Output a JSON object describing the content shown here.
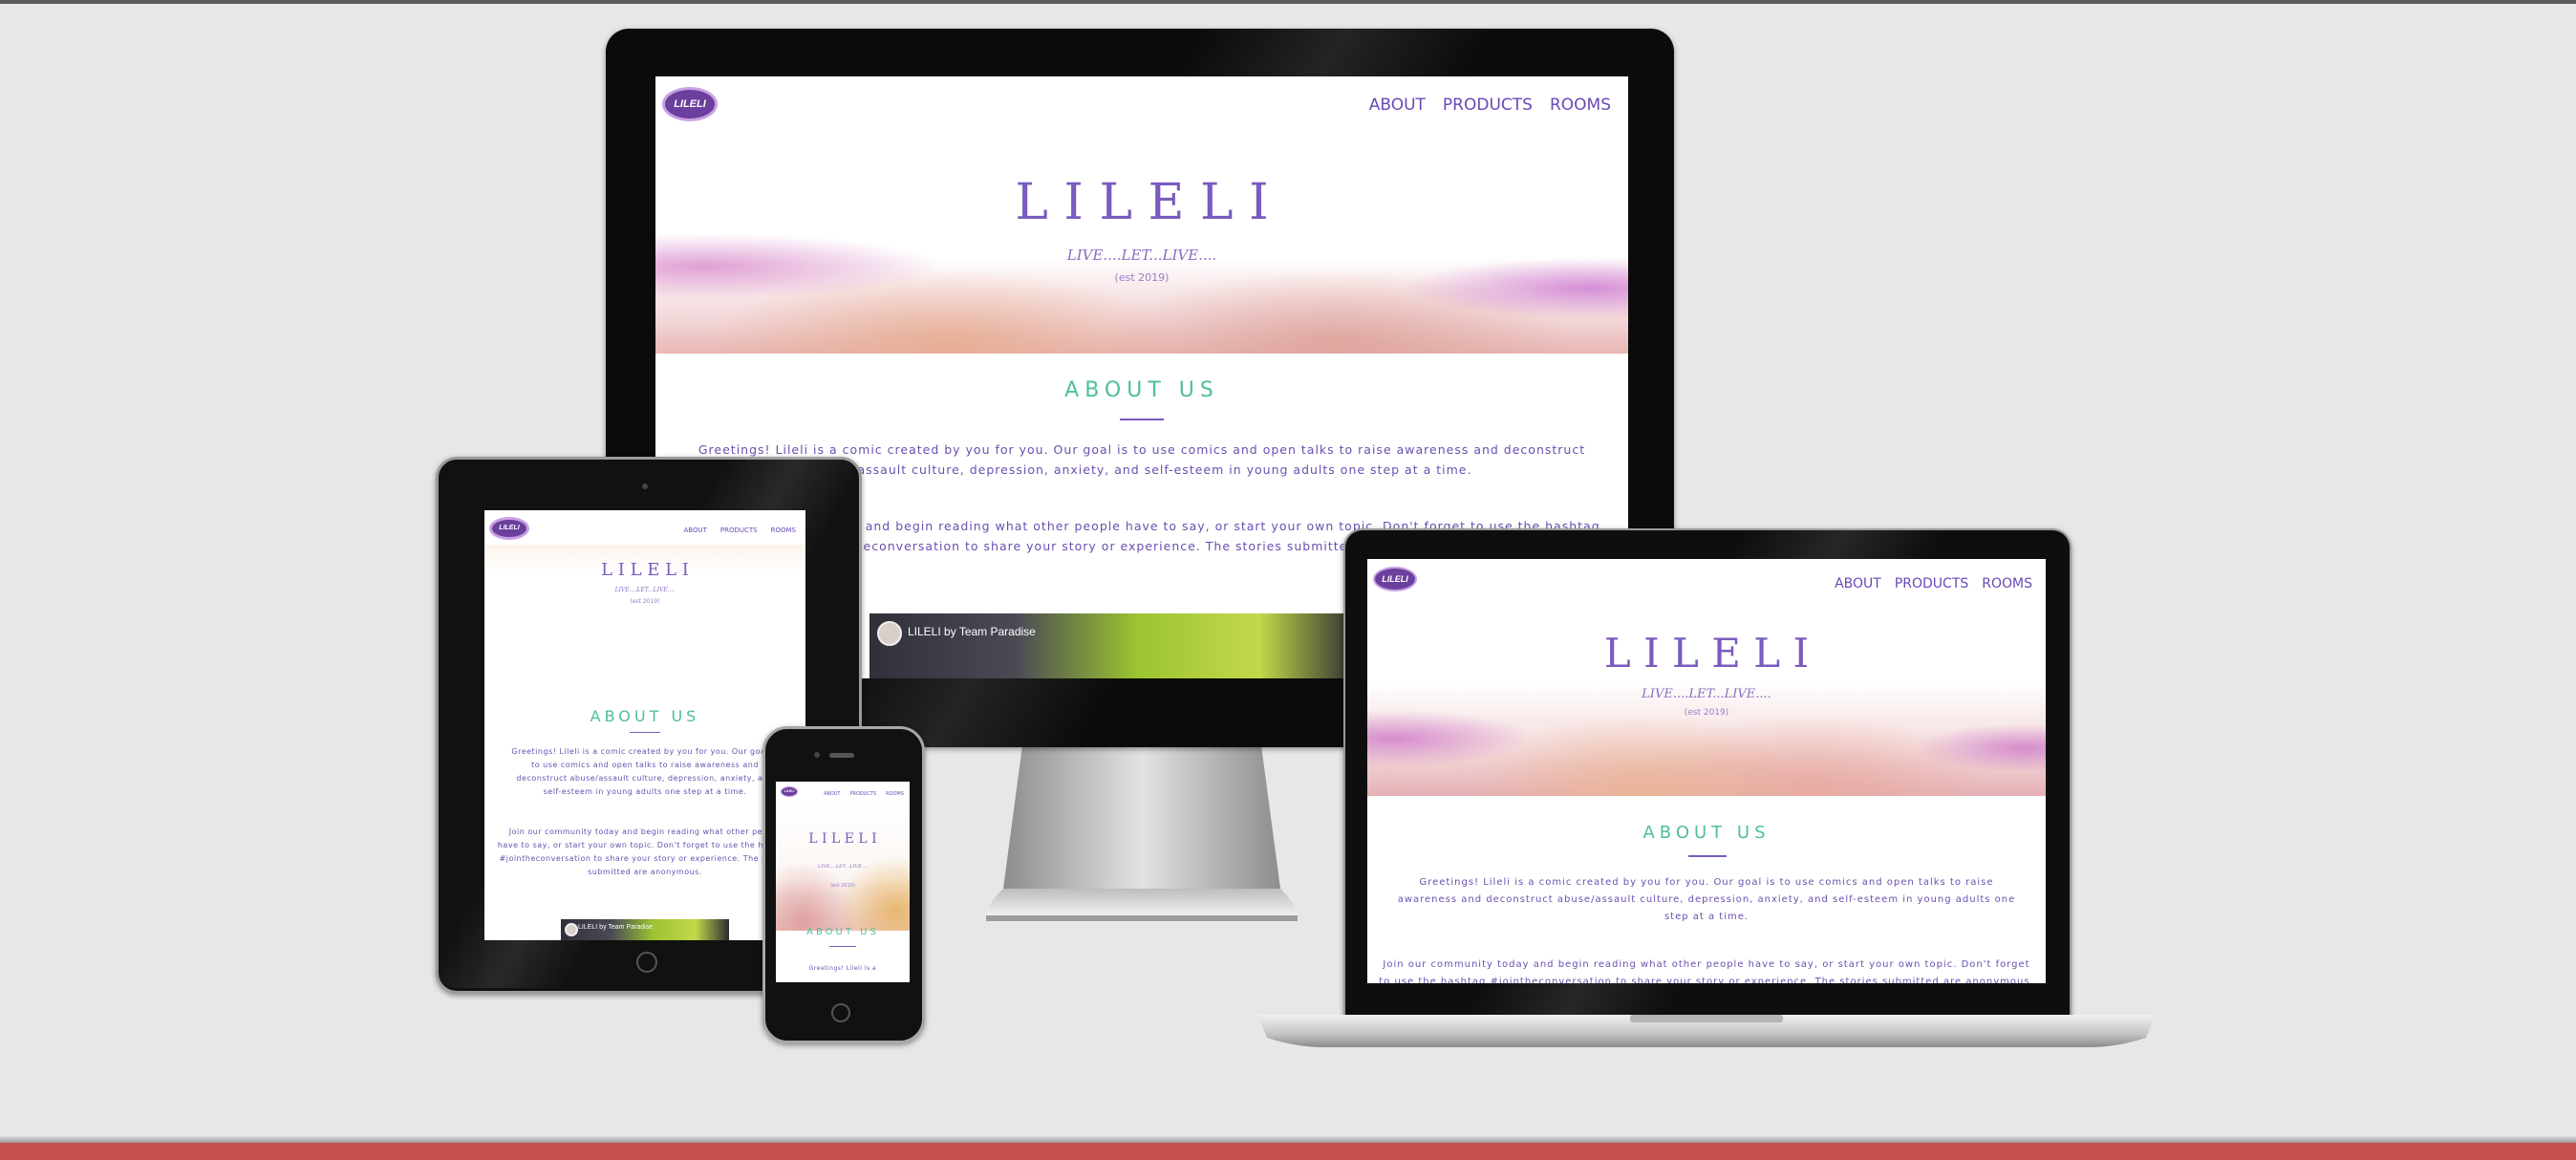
{
  "site": {
    "logo": "LILELI",
    "nav": [
      "ABOUT",
      "PRODUCTS",
      "ROOMS"
    ],
    "title": "L I L E L I",
    "tagline": "LIVE....LET...LIVE....",
    "est": "(est 2019)",
    "about_heading": "ABOUT US",
    "video_title": "LILELI by Team Paradise"
  },
  "monitor": {
    "p1_l1": "Greetings! Lileli is a comic created by you for you. Our goal is to use comics and open talks to raise awareness and deconstruct",
    "p1_l2": "abuse/assault culture, depression, anxiety, and self-esteem in young adults one step at a time.",
    "p2_l1": "Join our community today and begin reading what other people have to say, or start your own topic. Don't forget to use the hashtag",
    "p2_l2": "#jointheconversation to share your story or experience. The stories submitted are anonymous."
  },
  "tablet": {
    "p1_l1": "Greetings! Lileli is a comic created by you for you. Our goal is",
    "p1_l2": "to use comics and open talks to raise awareness and",
    "p1_l3": "deconstruct abuse/assault culture, depression, anxiety, and",
    "p1_l4": "self-esteem in young adults one step at a time.",
    "p2_l1": "Join our community today and begin reading what other people",
    "p2_l2": "have to say, or start your own topic. Don't forget to use the hashtag",
    "p2_l3": "#jointheconversation to share your story or experience. The stories",
    "p2_l4": "submitted are anonymous."
  },
  "phone": {
    "p1_l1": "Greetings! Lileli is a"
  },
  "laptop": {
    "p1_l1": "Greetings! Lileli is a comic created by you for you. Our goal is to use comics and open talks to raise",
    "p1_l2": "awareness and deconstruct abuse/assault culture, depression, anxiety, and self-esteem in young adults one",
    "p1_l3": "step at a time.",
    "p2_l1": "Join our community today and begin reading what other people have to say, or start your own topic. Don't forget",
    "p2_l2": "to use the hashtag #jointheconversation to share your story or experience. The stories submitted are anonymous."
  },
  "colors": {
    "purple": "#6a48b8",
    "teal": "#4fbf97",
    "background": "#e7e7e7",
    "footer_bar": "#c5504b"
  }
}
